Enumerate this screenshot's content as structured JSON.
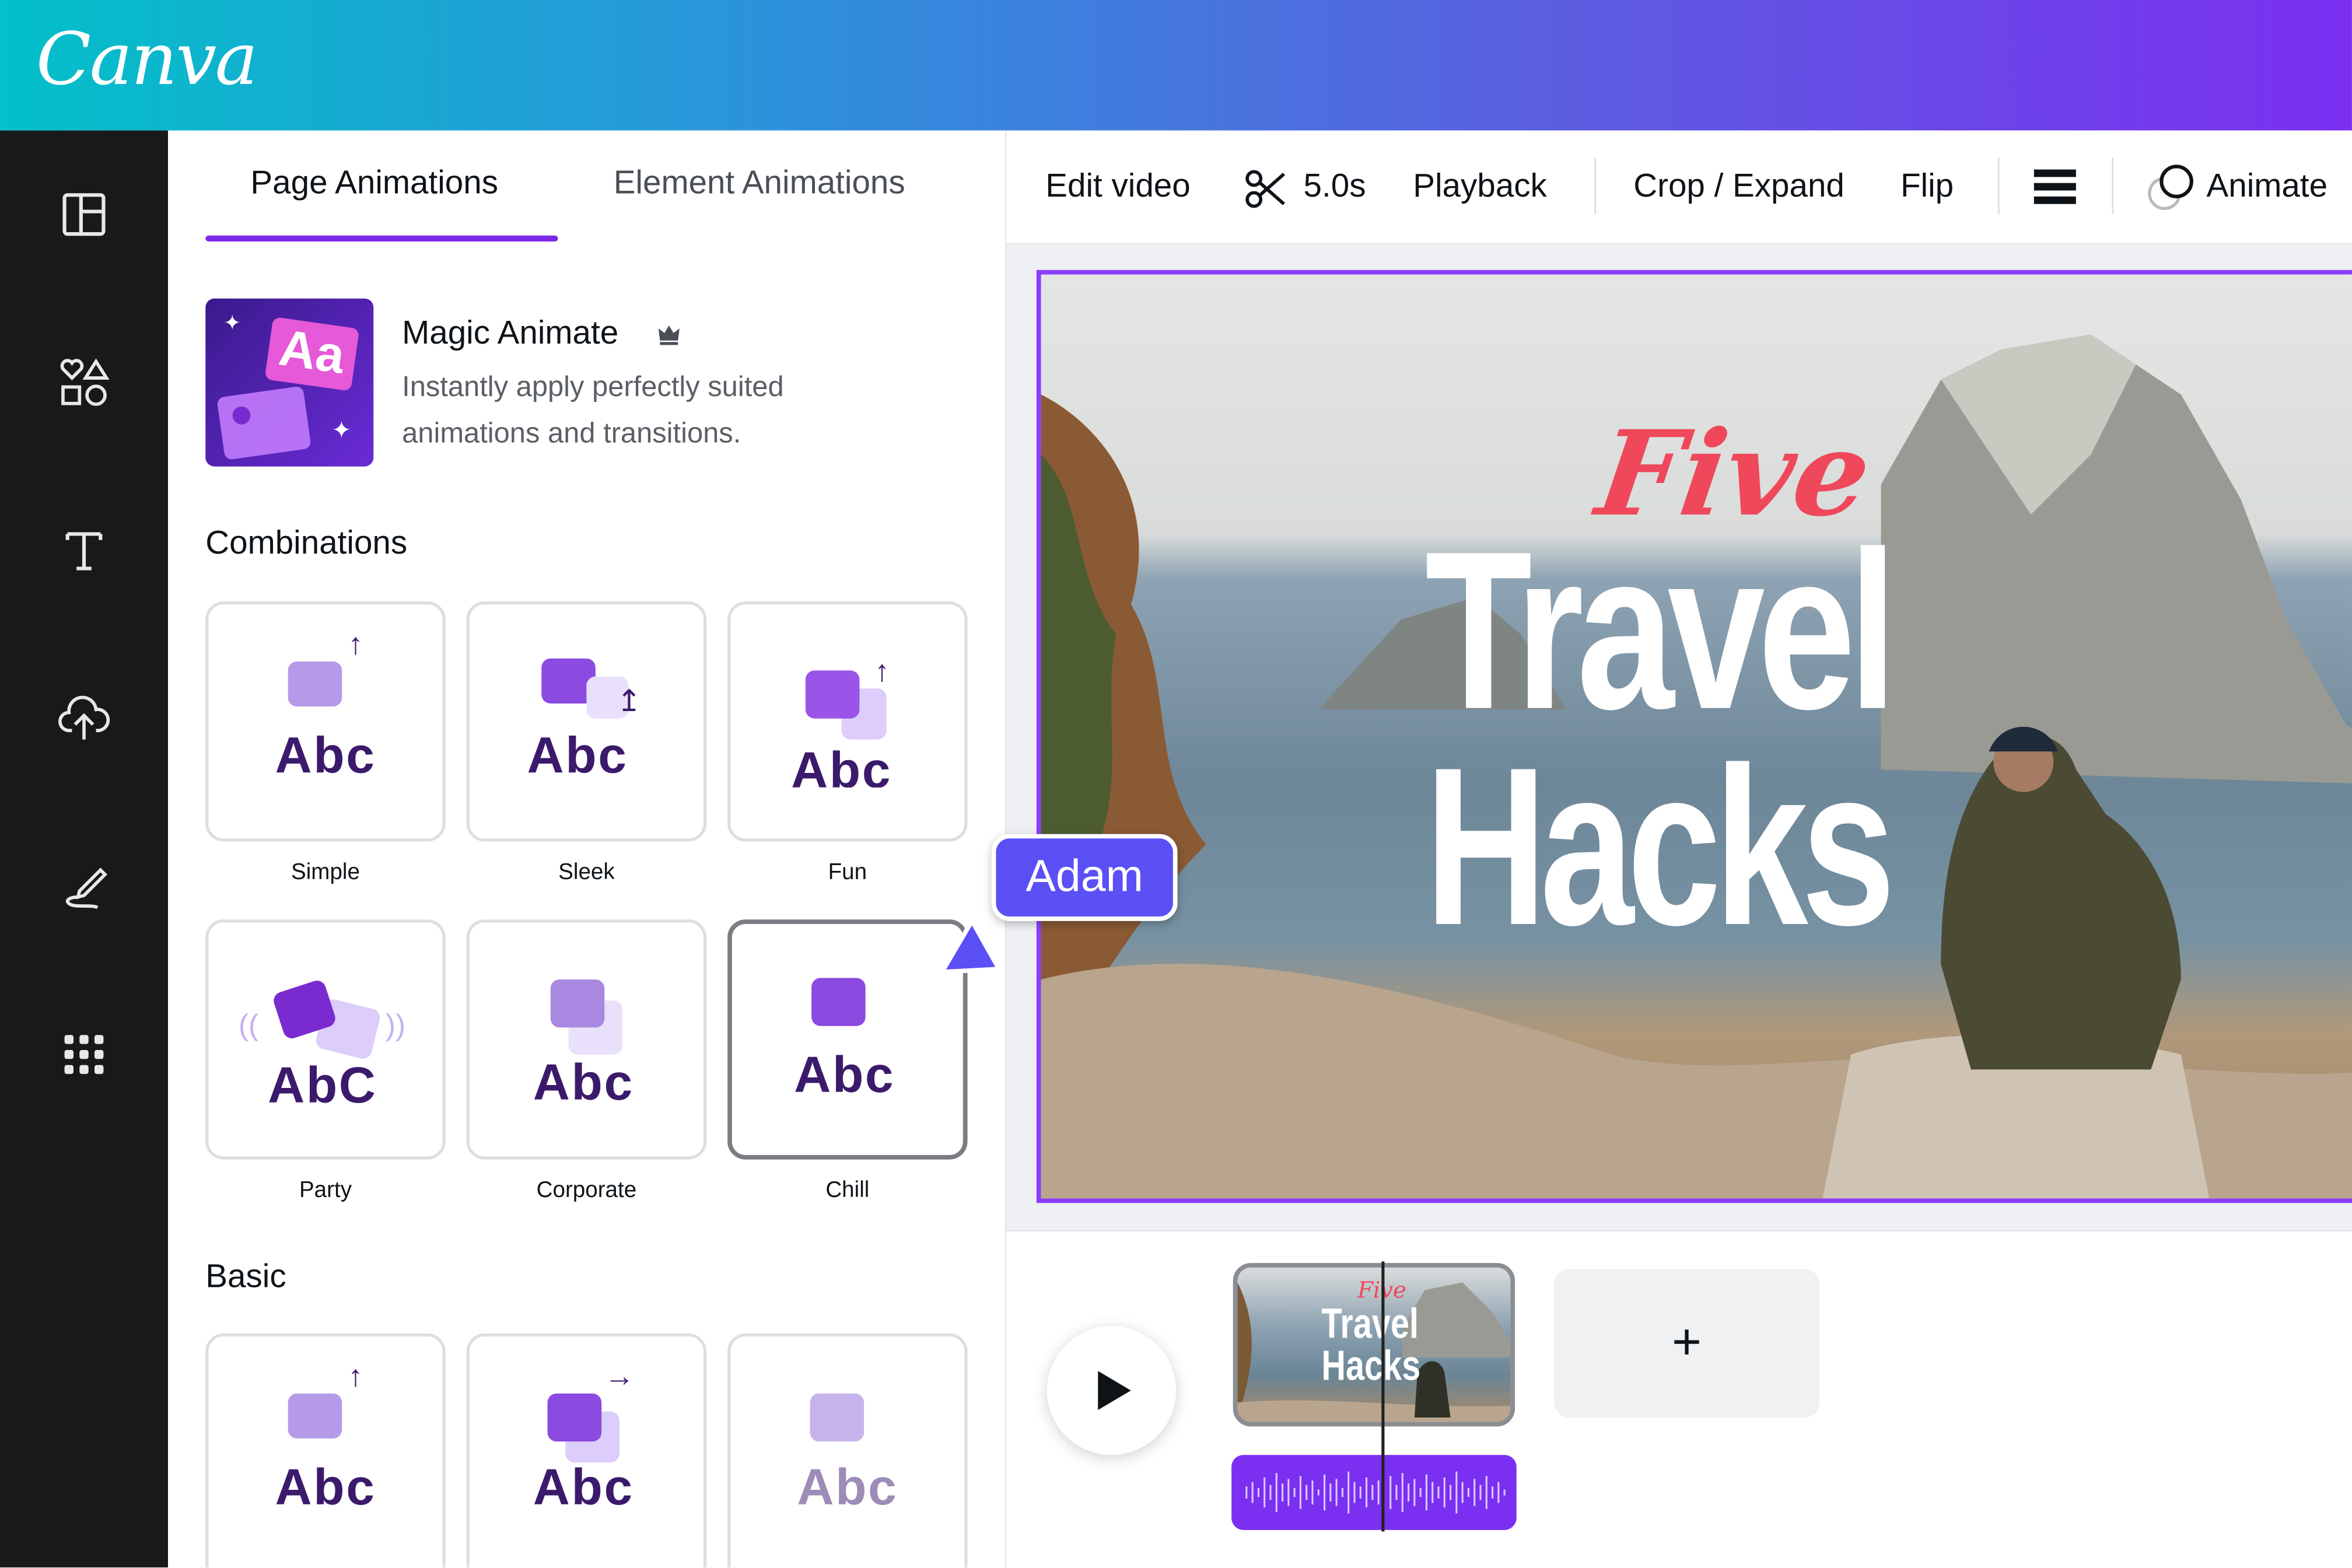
{
  "app": {
    "logo": "Canva"
  },
  "rail": {
    "items": [
      "templates-icon",
      "elements-icon",
      "text-icon",
      "uploads-icon",
      "draw-icon",
      "apps-icon"
    ]
  },
  "panel": {
    "tabs": [
      {
        "label": "Page Animations",
        "active": true
      },
      {
        "label": "Element Animations",
        "active": false
      }
    ],
    "magic": {
      "title": "Magic Animate",
      "description": "Instantly apply perfectly suited animations and transitions.",
      "thumb_text": "Aa"
    },
    "combinations_title": "Combinations",
    "combinations": [
      {
        "label": "Simple",
        "abc": "Abc"
      },
      {
        "label": "Sleek",
        "abc": "Abc"
      },
      {
        "label": "Fun",
        "abc": "Abc"
      },
      {
        "label": "Party",
        "abc": "AbC"
      },
      {
        "label": "Corporate",
        "abc": "Abc"
      },
      {
        "label": "Chill",
        "abc": "Abc",
        "selected": true
      }
    ],
    "basic_title": "Basic",
    "basic": [
      {
        "abc": "Abc"
      },
      {
        "abc": "Abc"
      },
      {
        "abc": "Abc"
      }
    ]
  },
  "toolbar": {
    "edit_video": "Edit video",
    "duration": "5.0s",
    "playback": "Playback",
    "crop_expand": "Crop / Expand",
    "flip": "Flip",
    "animate": "Animate"
  },
  "design": {
    "line1": "Five",
    "line2": "Travel",
    "line3": "Hacks"
  },
  "collaborator": {
    "name": "Adam"
  },
  "timeline": {
    "add_label": "+"
  },
  "colors": {
    "accent": "#7d2ae8",
    "cursor": "#5b4ff6",
    "five": "#f0485b",
    "rail": "#18191b"
  }
}
